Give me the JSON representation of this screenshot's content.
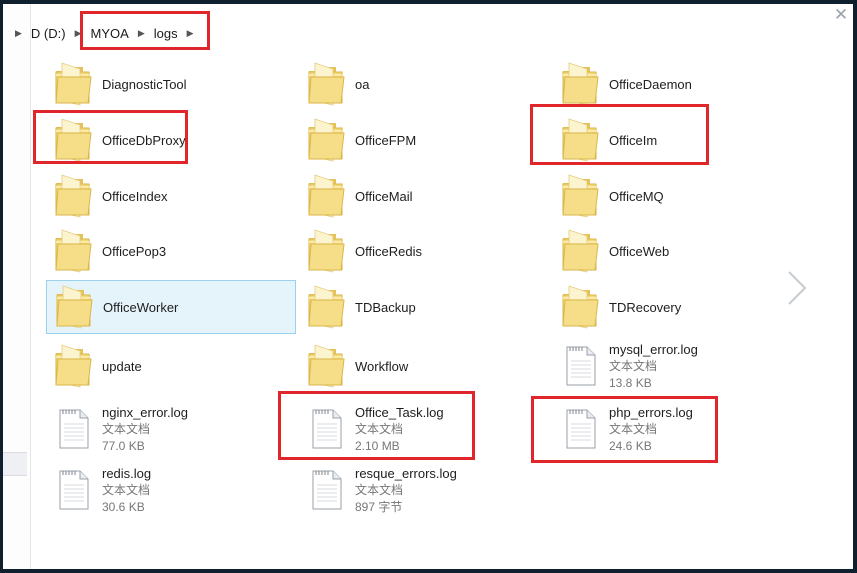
{
  "breadcrumb": [
    "D (D:)",
    "MYOA",
    "logs"
  ],
  "items": [
    {
      "type": "folder",
      "name": "DiagnosticTool"
    },
    {
      "type": "folder",
      "name": "oa"
    },
    {
      "type": "folder",
      "name": "OfficeDaemon"
    },
    {
      "type": "folder",
      "name": "OfficeDbProxy"
    },
    {
      "type": "folder",
      "name": "OfficeFPM"
    },
    {
      "type": "folder",
      "name": "OfficeIm"
    },
    {
      "type": "folder",
      "name": "OfficeIndex"
    },
    {
      "type": "folder",
      "name": "OfficeMail"
    },
    {
      "type": "folder",
      "name": "OfficeMQ"
    },
    {
      "type": "folder",
      "name": "OfficePop3"
    },
    {
      "type": "folder",
      "name": "OfficeRedis"
    },
    {
      "type": "folder",
      "name": "OfficeWeb"
    },
    {
      "type": "folder",
      "name": "OfficeWorker"
    },
    {
      "type": "folder",
      "name": "TDBackup"
    },
    {
      "type": "folder",
      "name": "TDRecovery"
    },
    {
      "type": "folder",
      "name": "update"
    },
    {
      "type": "folder",
      "name": "Workflow"
    },
    {
      "type": "file",
      "name": "mysql_error.log",
      "kind": "文本文档",
      "size": "13.8 KB"
    },
    {
      "type": "file",
      "name": "nginx_error.log",
      "kind": "文本文档",
      "size": "77.0 KB"
    },
    {
      "type": "file",
      "name": "Office_Task.log",
      "kind": "文本文档",
      "size": "2.10 MB"
    },
    {
      "type": "file",
      "name": "php_errors.log",
      "kind": "文本文档",
      "size": "24.6 KB"
    },
    {
      "type": "file",
      "name": "redis.log",
      "kind": "文本文档",
      "size": "30.6 KB"
    },
    {
      "type": "file",
      "name": "resque_errors.log",
      "kind": "文本文档",
      "size": "897 字节"
    }
  ],
  "selected_item": "OfficeWorker",
  "colors": {
    "highlight": "#e0262b",
    "selection_bg": "#e5f3fb",
    "selection_border": "#99d1ee",
    "folder": "#f3d97a"
  },
  "icons": {
    "close": "close-icon",
    "next": "chevron-right-icon",
    "folder": "folder-icon",
    "file": "text-file-icon"
  }
}
